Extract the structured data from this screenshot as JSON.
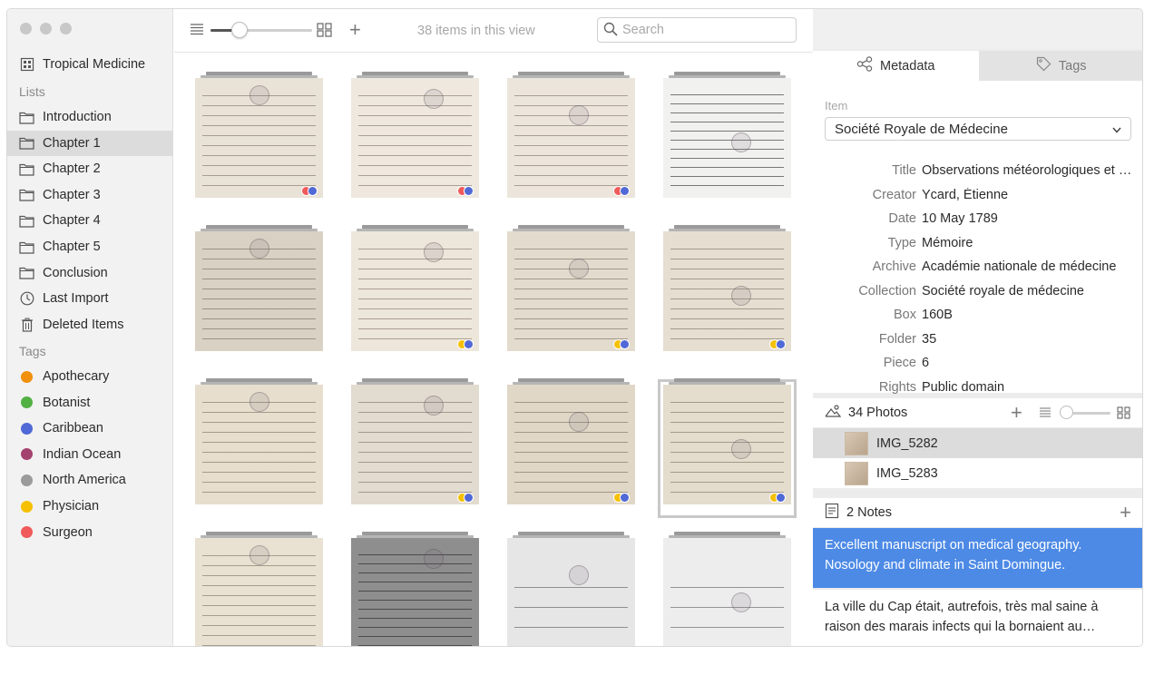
{
  "sidebar": {
    "library": {
      "label": "Tropical Medicine",
      "icon": "library-icon"
    },
    "lists_heading": "Lists",
    "lists": [
      {
        "label": "Introduction",
        "icon": "folder-icon",
        "selected": false
      },
      {
        "label": "Chapter 1",
        "icon": "folder-icon",
        "selected": true
      },
      {
        "label": "Chapter 2",
        "icon": "folder-icon",
        "selected": false
      },
      {
        "label": "Chapter 3",
        "icon": "folder-icon",
        "selected": false
      },
      {
        "label": "Chapter 4",
        "icon": "folder-icon",
        "selected": false
      },
      {
        "label": "Chapter 5",
        "icon": "folder-icon",
        "selected": false
      },
      {
        "label": "Conclusion",
        "icon": "folder-icon",
        "selected": false
      },
      {
        "label": "Last Import",
        "icon": "clock-icon",
        "selected": false
      },
      {
        "label": "Deleted Items",
        "icon": "trash-icon",
        "selected": false
      }
    ],
    "tags_heading": "Tags",
    "tags": [
      {
        "label": "Apothecary",
        "color": "#f0900c"
      },
      {
        "label": "Botanist",
        "color": "#52b043"
      },
      {
        "label": "Caribbean",
        "color": "#5069d6"
      },
      {
        "label": "Indian Ocean",
        "color": "#a3426f"
      },
      {
        "label": "North America",
        "color": "#9b9b9b"
      },
      {
        "label": "Physician",
        "color": "#f5c002"
      },
      {
        "label": "Surgeon",
        "color": "#f05a5a"
      }
    ]
  },
  "toolbar": {
    "count": "38 items in this view",
    "search_placeholder": "Search",
    "zoom_level": 0.27
  },
  "grid": {
    "items": [
      {
        "tone": "#e9e2d6",
        "ink": "normal",
        "badges": [
          "#f05a5a",
          "#5069d6"
        ],
        "selected": false
      },
      {
        "tone": "#eee8df",
        "ink": "normal",
        "badges": [
          "#f05a5a",
          "#5069d6"
        ],
        "selected": false
      },
      {
        "tone": "#ebe5dc",
        "ink": "normal",
        "badges": [
          "#f05a5a",
          "#5069d6"
        ],
        "selected": false
      },
      {
        "tone": "#f1f1f0",
        "ink": "dark",
        "badges": [],
        "selected": false
      },
      {
        "tone": "#d9d1c3",
        "ink": "normal",
        "badges": [],
        "selected": false
      },
      {
        "tone": "#ede6da",
        "ink": "normal",
        "badges": [
          "#f5c002",
          "#5069d6"
        ],
        "selected": false
      },
      {
        "tone": "#e3dbcd",
        "ink": "normal",
        "badges": [
          "#f5c002",
          "#5069d6"
        ],
        "selected": false
      },
      {
        "tone": "#e6ded0",
        "ink": "normal",
        "badges": [
          "#f5c002",
          "#5069d6"
        ],
        "selected": false
      },
      {
        "tone": "#e7dece",
        "ink": "normal",
        "badges": [],
        "selected": false
      },
      {
        "tone": "#e2dbcf",
        "ink": "normal",
        "badges": [
          "#f5c002",
          "#5069d6"
        ],
        "selected": false
      },
      {
        "tone": "#e0d7c7",
        "ink": "normal",
        "badges": [
          "#f5c002",
          "#5069d6"
        ],
        "selected": false
      },
      {
        "tone": "#e4dccd",
        "ink": "normal",
        "badges": [
          "#f5c002",
          "#5069d6"
        ],
        "selected": true
      },
      {
        "tone": "#e9e1d1",
        "ink": "normal",
        "badges": [],
        "selected": false
      },
      {
        "tone": "#8e8e8e",
        "ink": "dark",
        "badges": [
          "#f5c002"
        ],
        "selected": false
      },
      {
        "tone": "#e6e6e6",
        "ink": "sparse",
        "badges": [
          "#f05a5a"
        ],
        "selected": false
      },
      {
        "tone": "#ededed",
        "ink": "sparse",
        "badges": [
          "#f05a5a"
        ],
        "selected": false
      }
    ]
  },
  "inspector": {
    "tabs": [
      {
        "label": "Metadata",
        "icon": "share-nodes-icon",
        "active": true
      },
      {
        "label": "Tags",
        "icon": "tag-icon",
        "active": false
      }
    ],
    "item_label": "Item",
    "item_value": "Société Royale de Médecine",
    "fields": [
      {
        "key": "Title",
        "value": "Observations météorologiques et médicales faites au Cap"
      },
      {
        "key": "Creator",
        "value": "Ycard, Étienne"
      },
      {
        "key": "Date",
        "value": "10 May 1789"
      },
      {
        "key": "Type",
        "value": "Mémoire"
      },
      {
        "key": "Archive",
        "value": "Académie nationale de médecine"
      },
      {
        "key": "Collection",
        "value": "Société royale de médecine"
      },
      {
        "key": "Box",
        "value": "160B"
      },
      {
        "key": "Folder",
        "value": "35"
      },
      {
        "key": "Piece",
        "value": "6"
      },
      {
        "key": "Rights",
        "value": "Public domain"
      }
    ],
    "photos_heading": "34 Photos",
    "photos_zoom": 0.05,
    "photos": [
      {
        "label": "IMG_5282",
        "selected": true
      },
      {
        "label": "IMG_5283",
        "selected": false
      }
    ],
    "notes_heading": "2 Notes",
    "notes": [
      {
        "lines": [
          "Excellent manuscript on medical geography.",
          "Nosology and climate in Saint Domingue."
        ],
        "selected": true
      },
      {
        "lines": [
          "La ville du Cap était, autrefois, très mal saine à",
          "raison des marais infects qui la bornaient au…"
        ],
        "selected": false
      }
    ]
  }
}
